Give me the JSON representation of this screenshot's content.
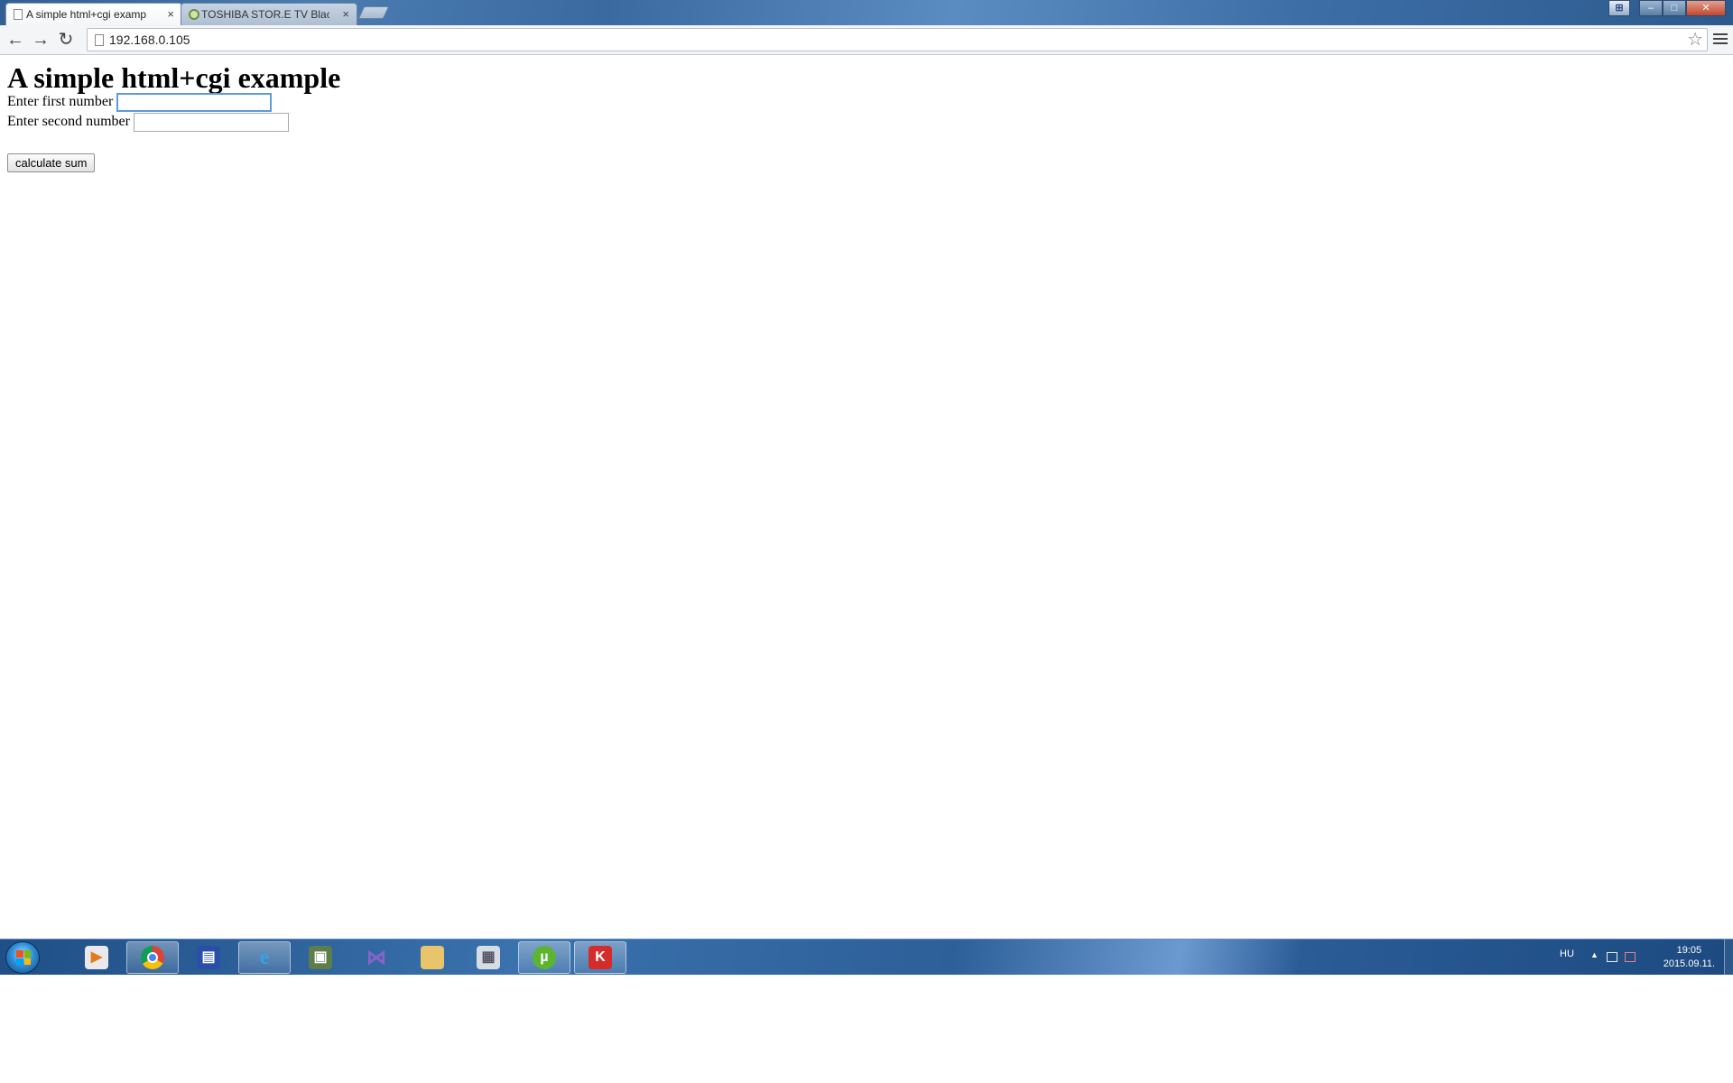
{
  "browser": {
    "tabs": [
      {
        "label": "A simple html+cgi examp",
        "close": "×"
      },
      {
        "label": "TOSHIBA STOR.E TV Black",
        "close": "×"
      }
    ],
    "address": "192.168.0.105",
    "star": "☆"
  },
  "page": {
    "heading": "A simple html+cgi example",
    "first_label": "Enter first number",
    "first_value": "",
    "second_label": "Enter second number",
    "second_value": "",
    "submit_label": "calculate sum"
  },
  "taskbar": {
    "lang": "HU",
    "time": "19:05",
    "date": "2015.09.11."
  },
  "colors": {
    "focus": "#5b9dd9",
    "taskbar": "#2d5f98"
  }
}
